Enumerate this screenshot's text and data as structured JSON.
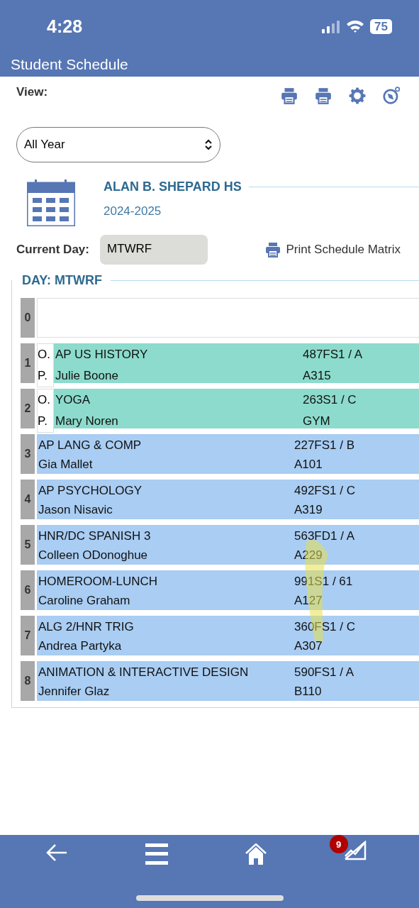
{
  "status_bar": {
    "time": "4:28",
    "battery": "75"
  },
  "header": {
    "title": "Student Schedule"
  },
  "toolbar": {
    "label": "View:"
  },
  "term_select": {
    "value": "All Year"
  },
  "school": {
    "name": "ALAN B. SHEPARD HS",
    "year": "2024-2025"
  },
  "current_day": {
    "label": "Current Day:",
    "value": "MTWRF"
  },
  "print_matrix": {
    "label": "Print Schedule Matrix"
  },
  "schedule": {
    "legend": "DAY: MTWRF",
    "rows": [
      {
        "period": "0",
        "kind": "empty"
      },
      {
        "period": "1",
        "kind": "open",
        "marker": "O. P.",
        "course": "AP US HISTORY",
        "teacher": "Julie Boone",
        "section": "487FS1 / A",
        "room": "A315"
      },
      {
        "period": "2",
        "kind": "open",
        "marker": "O. P.",
        "course": "YOGA",
        "teacher": "Mary Noren",
        "section": "263S1 / C",
        "room": "GYM"
      },
      {
        "period": "3",
        "kind": "class",
        "course": "AP LANG & COMP",
        "teacher": "Gia Mallet",
        "section": "227FS1 / B",
        "room": "A101"
      },
      {
        "period": "4",
        "kind": "class",
        "course": "AP PSYCHOLOGY",
        "teacher": "Jason Nisavic",
        "section": "492FS1 / C",
        "room": "A319"
      },
      {
        "period": "5",
        "kind": "class",
        "course": "HNR/DC SPANISH 3",
        "teacher": "Colleen ODonoghue",
        "section": "563FD1 / A",
        "room": "A229"
      },
      {
        "period": "6",
        "kind": "class",
        "course": "HOMEROOM-LUNCH",
        "teacher": "Caroline Graham",
        "section": "991S1 / 61",
        "room": "A127"
      },
      {
        "period": "7",
        "kind": "class",
        "course": "ALG 2/HNR TRIG",
        "teacher": "Andrea Partyka",
        "section": "360FS1 / C",
        "room": "A307"
      },
      {
        "period": "8",
        "kind": "class",
        "course": "ANIMATION & INTERACTIVE DESIGN",
        "teacher": "Jennifer Glaz",
        "section": "590FS1 / A",
        "room": "B110"
      }
    ]
  },
  "bottom_nav": {
    "badge": "9"
  }
}
